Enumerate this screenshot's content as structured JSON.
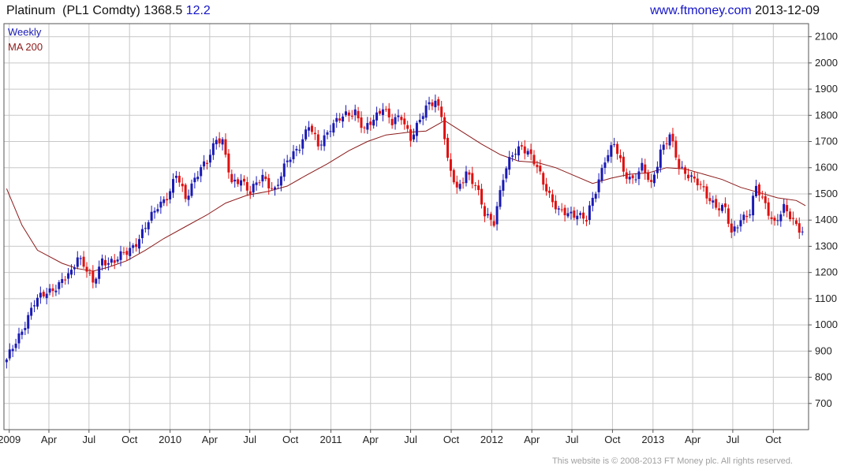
{
  "header": {
    "instrument": "Platinum",
    "ticker": "(PL1 Comdty)",
    "last": "1368.5",
    "change": "12.2",
    "site": "www.ftmoney.com",
    "date": "2013-12-09"
  },
  "footer": "This website is © 2008-2013 FT Money plc. All rights reserved.",
  "colors": {
    "up": "#1a1ab4",
    "down": "#e01010",
    "ma": "#8b1a1a",
    "grid": "#c8c8c8",
    "frame": "#555555"
  },
  "chart_data": {
    "type": "candlestick",
    "legend": [
      "Weekly",
      "MA 200"
    ],
    "grid": true,
    "y_axis_side": "right",
    "ylim": [
      600,
      2150
    ],
    "yticks": [
      700,
      800,
      900,
      1000,
      1100,
      1200,
      1300,
      1400,
      1500,
      1600,
      1700,
      1800,
      1900,
      2000,
      2100
    ],
    "xlim": [
      "2008-12-20",
      "2013-12-20"
    ],
    "xticks": [
      {
        "date": "2009-01-01",
        "label": "2009"
      },
      {
        "date": "2009-04-01",
        "label": "Apr"
      },
      {
        "date": "2009-07-01",
        "label": "Jul"
      },
      {
        "date": "2009-10-01",
        "label": "Oct"
      },
      {
        "date": "2010-01-01",
        "label": "2010"
      },
      {
        "date": "2010-04-01",
        "label": "Apr"
      },
      {
        "date": "2010-07-01",
        "label": "Jul"
      },
      {
        "date": "2010-10-01",
        "label": "Oct"
      },
      {
        "date": "2011-01-01",
        "label": "2011"
      },
      {
        "date": "2011-04-01",
        "label": "Apr"
      },
      {
        "date": "2011-07-01",
        "label": "Jul"
      },
      {
        "date": "2011-10-01",
        "label": "Oct"
      },
      {
        "date": "2012-01-01",
        "label": "2012"
      },
      {
        "date": "2012-04-01",
        "label": "Apr"
      },
      {
        "date": "2012-07-01",
        "label": "Jul"
      },
      {
        "date": "2012-10-01",
        "label": "Oct"
      },
      {
        "date": "2013-01-01",
        "label": "2013"
      },
      {
        "date": "2013-04-01",
        "label": "Apr"
      },
      {
        "date": "2013-07-01",
        "label": "Jul"
      },
      {
        "date": "2013-10-01",
        "label": "Oct"
      }
    ],
    "series": [
      {
        "name": "Weekly",
        "close_anchors": [
          [
            "2008-12-26",
            860
          ],
          [
            "2009-01-23",
            960
          ],
          [
            "2009-02-27",
            1080
          ],
          [
            "2009-03-27",
            1130
          ],
          [
            "2009-04-24",
            1150
          ],
          [
            "2009-05-22",
            1200
          ],
          [
            "2009-06-05",
            1270
          ],
          [
            "2009-06-26",
            1210
          ],
          [
            "2009-07-10",
            1150
          ],
          [
            "2009-07-31",
            1250
          ],
          [
            "2009-08-28",
            1240
          ],
          [
            "2009-09-25",
            1280
          ],
          [
            "2009-10-23",
            1330
          ],
          [
            "2009-11-13",
            1390
          ],
          [
            "2009-12-04",
            1460
          ],
          [
            "2009-12-31",
            1500
          ],
          [
            "2010-01-15",
            1570
          ],
          [
            "2010-02-05",
            1490
          ],
          [
            "2010-02-26",
            1560
          ],
          [
            "2010-03-26",
            1620
          ],
          [
            "2010-04-16",
            1720
          ],
          [
            "2010-04-30",
            1700
          ],
          [
            "2010-05-21",
            1530
          ],
          [
            "2010-06-11",
            1560
          ],
          [
            "2010-07-02",
            1510
          ],
          [
            "2010-07-30",
            1560
          ],
          [
            "2010-08-27",
            1520
          ],
          [
            "2010-09-24",
            1620
          ],
          [
            "2010-10-22",
            1690
          ],
          [
            "2010-11-12",
            1760
          ],
          [
            "2010-12-03",
            1680
          ],
          [
            "2010-12-31",
            1760
          ],
          [
            "2011-01-28",
            1790
          ],
          [
            "2011-02-25",
            1820
          ],
          [
            "2011-03-18",
            1740
          ],
          [
            "2011-04-08",
            1780
          ],
          [
            "2011-04-29",
            1840
          ],
          [
            "2011-05-20",
            1770
          ],
          [
            "2011-06-10",
            1790
          ],
          [
            "2011-07-01",
            1720
          ],
          [
            "2011-07-22",
            1780
          ],
          [
            "2011-08-12",
            1840
          ],
          [
            "2011-08-26",
            1860
          ],
          [
            "2011-09-09",
            1810
          ],
          [
            "2011-09-23",
            1620
          ],
          [
            "2011-10-14",
            1510
          ],
          [
            "2011-11-04",
            1590
          ],
          [
            "2011-11-25",
            1530
          ],
          [
            "2011-12-16",
            1420
          ],
          [
            "2012-01-06",
            1400
          ],
          [
            "2012-01-27",
            1560
          ],
          [
            "2012-02-17",
            1650
          ],
          [
            "2012-03-09",
            1690
          ],
          [
            "2012-03-30",
            1640
          ],
          [
            "2012-04-20",
            1570
          ],
          [
            "2012-05-11",
            1500
          ],
          [
            "2012-06-01",
            1430
          ],
          [
            "2012-06-22",
            1420
          ],
          [
            "2012-07-13",
            1430
          ],
          [
            "2012-08-03",
            1400
          ],
          [
            "2012-08-24",
            1510
          ],
          [
            "2012-09-14",
            1640
          ],
          [
            "2012-10-05",
            1690
          ],
          [
            "2012-10-26",
            1580
          ],
          [
            "2012-11-16",
            1560
          ],
          [
            "2012-12-07",
            1600
          ],
          [
            "2012-12-28",
            1530
          ],
          [
            "2013-01-18",
            1670
          ],
          [
            "2013-02-08",
            1720
          ],
          [
            "2013-03-01",
            1600
          ],
          [
            "2013-03-22",
            1580
          ],
          [
            "2013-04-12",
            1540
          ],
          [
            "2013-05-03",
            1490
          ],
          [
            "2013-05-24",
            1460
          ],
          [
            "2013-06-14",
            1440
          ],
          [
            "2013-06-28",
            1340
          ],
          [
            "2013-07-19",
            1410
          ],
          [
            "2013-08-09",
            1430
          ],
          [
            "2013-08-23",
            1520
          ],
          [
            "2013-09-13",
            1460
          ],
          [
            "2013-10-04",
            1390
          ],
          [
            "2013-10-25",
            1440
          ],
          [
            "2013-11-15",
            1400
          ],
          [
            "2013-12-06",
            1360
          ]
        ]
      },
      {
        "name": "MA 200",
        "points": [
          [
            "2008-12-26",
            1520
          ],
          [
            "2009-01-30",
            1380
          ],
          [
            "2009-03-06",
            1285
          ],
          [
            "2009-04-03",
            1260
          ],
          [
            "2009-05-01",
            1235
          ],
          [
            "2009-06-05",
            1215
          ],
          [
            "2009-07-10",
            1205
          ],
          [
            "2009-08-14",
            1220
          ],
          [
            "2009-09-25",
            1245
          ],
          [
            "2009-11-06",
            1285
          ],
          [
            "2009-12-18",
            1330
          ],
          [
            "2010-02-05",
            1375
          ],
          [
            "2010-03-26",
            1420
          ],
          [
            "2010-05-07",
            1465
          ],
          [
            "2010-06-25",
            1495
          ],
          [
            "2010-08-13",
            1510
          ],
          [
            "2010-09-24",
            1530
          ],
          [
            "2010-11-05",
            1570
          ],
          [
            "2010-12-24",
            1615
          ],
          [
            "2011-02-11",
            1665
          ],
          [
            "2011-03-25",
            1700
          ],
          [
            "2011-05-06",
            1725
          ],
          [
            "2011-06-24",
            1735
          ],
          [
            "2011-08-05",
            1740
          ],
          [
            "2011-09-16",
            1780
          ],
          [
            "2011-10-28",
            1735
          ],
          [
            "2011-12-09",
            1690
          ],
          [
            "2012-01-20",
            1650
          ],
          [
            "2012-03-02",
            1625
          ],
          [
            "2012-04-13",
            1620
          ],
          [
            "2012-05-25",
            1600
          ],
          [
            "2012-07-06",
            1570
          ],
          [
            "2012-08-17",
            1540
          ],
          [
            "2012-09-28",
            1560
          ],
          [
            "2012-11-09",
            1575
          ],
          [
            "2012-12-21",
            1580
          ],
          [
            "2013-02-01",
            1600
          ],
          [
            "2013-03-15",
            1595
          ],
          [
            "2013-04-26",
            1575
          ],
          [
            "2013-06-07",
            1555
          ],
          [
            "2013-07-19",
            1525
          ],
          [
            "2013-08-30",
            1505
          ],
          [
            "2013-10-11",
            1485
          ],
          [
            "2013-11-22",
            1475
          ],
          [
            "2013-12-13",
            1455
          ]
        ]
      }
    ]
  }
}
